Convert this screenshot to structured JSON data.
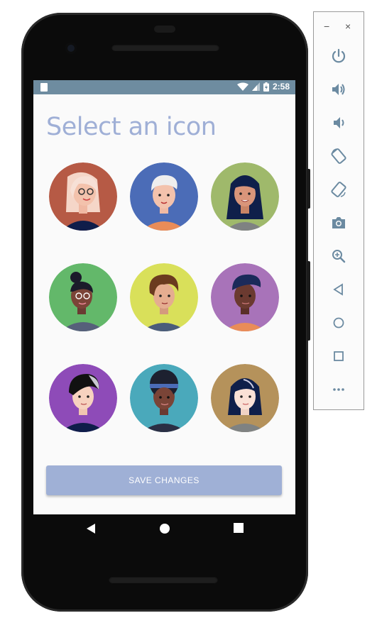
{
  "status_bar": {
    "time": "2:58"
  },
  "screen": {
    "title": "Select an icon",
    "save_label": "SAVE CHANGES",
    "avatars": [
      {
        "name": "avatar-1",
        "bg": "#b65a45"
      },
      {
        "name": "avatar-2",
        "bg": "#4b6cb7"
      },
      {
        "name": "avatar-3",
        "bg": "#9fb96b"
      },
      {
        "name": "avatar-4",
        "bg": "#63b86a"
      },
      {
        "name": "avatar-5",
        "bg": "#d9e05a"
      },
      {
        "name": "avatar-6",
        "bg": "#a873b9"
      },
      {
        "name": "avatar-7",
        "bg": "#8e4bb8"
      },
      {
        "name": "avatar-8",
        "bg": "#4aa9bb"
      },
      {
        "name": "avatar-9",
        "bg": "#b5925b"
      }
    ]
  },
  "emulator": {
    "minimize": "−",
    "close": "×",
    "controls": [
      "power-icon",
      "volume-up-icon",
      "volume-down-icon",
      "rotate-left-icon",
      "rotate-right-icon",
      "camera-icon",
      "zoom-icon",
      "back-icon",
      "home-icon",
      "overview-icon",
      "more-icon"
    ]
  },
  "colors": {
    "title": "#9fafd6",
    "button": "#9fb0d6",
    "status_bar": "#6e8ca0",
    "emulator_icon": "#6b8aa1"
  }
}
